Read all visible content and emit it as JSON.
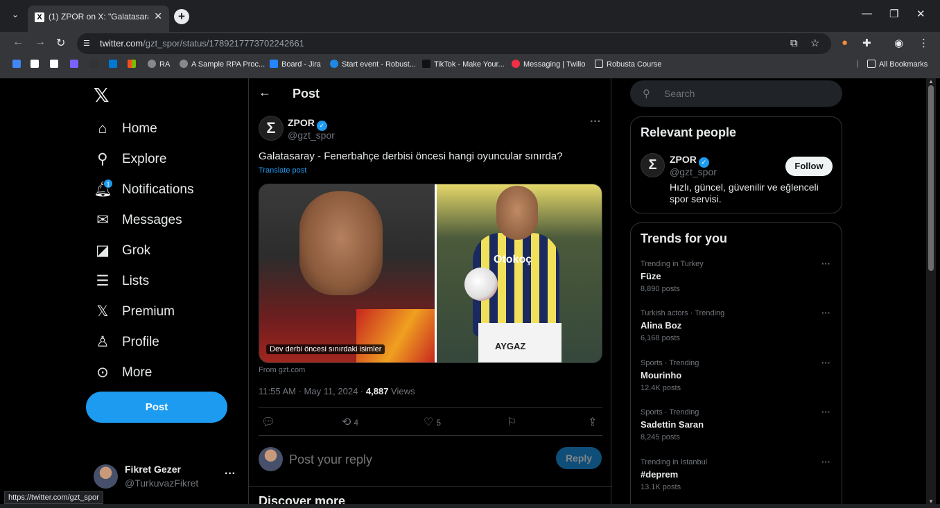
{
  "browser": {
    "tab_title": "(1) ZPOR on X: \"Galatasaray - Fe",
    "url_host": "twitter.com",
    "url_path": "/gzt_spor/status/1789217773702242661",
    "bookmarks": [
      "RA",
      "A Sample RPA Proc...",
      "Board - Jira",
      "Start event - Robust...",
      "TikTok - Make Your...",
      "Messaging | Twilio",
      "Robusta Course"
    ],
    "all_bookmarks": "All Bookmarks",
    "status_url": "https://twitter.com/gzt_spor"
  },
  "nav": {
    "items": [
      {
        "label": "Home",
        "icon": "home-icon"
      },
      {
        "label": "Explore",
        "icon": "search-icon"
      },
      {
        "label": "Notifications",
        "icon": "bell-icon",
        "badge": "1"
      },
      {
        "label": "Messages",
        "icon": "envelope-icon"
      },
      {
        "label": "Grok",
        "icon": "grok-icon"
      },
      {
        "label": "Lists",
        "icon": "list-icon"
      },
      {
        "label": "Premium",
        "icon": "x-logo-icon"
      },
      {
        "label": "Profile",
        "icon": "person-icon"
      },
      {
        "label": "More",
        "icon": "more-circle-icon"
      }
    ],
    "post_button": "Post",
    "account_name": "Fikret Gezer",
    "account_handle": "@TurkuvazFikret"
  },
  "post": {
    "header": "Post",
    "author_name": "ZPOR",
    "author_handle": "@gzt_spor",
    "text": "Galatasaray - Fenerbahçe derbisi öncesi hangi oyuncular sınırda?",
    "translate": "Translate post",
    "media_caption": "Dev derbi öncesi sınırdaki isimler",
    "jersey_text": "Otokoç",
    "shorts_text": "AYGAZ",
    "from": "From gzt.com",
    "time": "11:55 AM · May 11, 2024 · ",
    "views_count": "4,887",
    "views_label": " Views",
    "retweets": "4",
    "likes": "5",
    "reply_placeholder": "Post your reply",
    "reply_button": "Reply",
    "discover": "Discover more"
  },
  "sidebar": {
    "search_placeholder": "Search",
    "relevant_title": "Relevant people",
    "person_name": "ZPOR",
    "person_handle": "@gzt_spor",
    "person_bio": "Hızlı, güncel, güvenilir ve eğlenceli spor servisi.",
    "follow": "Follow",
    "trends_title": "Trends for you",
    "trends": [
      {
        "context": "Trending in Turkey",
        "name": "Füze",
        "posts": "8,890 posts"
      },
      {
        "context": "Turkish actors · Trending",
        "name": "Alina Boz",
        "posts": "6,168 posts"
      },
      {
        "context": "Sports · Trending",
        "name": "Mourinho",
        "posts": "12.4K posts"
      },
      {
        "context": "Sports · Trending",
        "name": "Sadettin Saran",
        "posts": "8,245 posts"
      },
      {
        "context": "Trending in Istanbul",
        "name": "#deprem",
        "posts": "13.1K posts"
      }
    ]
  },
  "colors": {
    "accent": "#1d9bf0",
    "background": "#000000",
    "border": "#2f3336"
  }
}
